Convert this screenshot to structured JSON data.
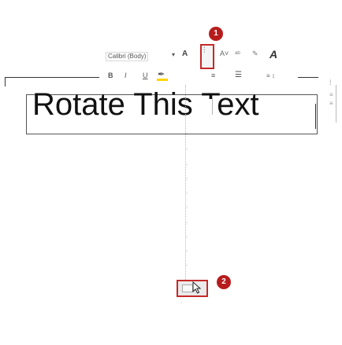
{
  "slide": {
    "text": "Rotate This Text"
  },
  "mini_toolbar": {
    "font_name": "Calibri (Body)",
    "font_dropdown_glyph": "▾",
    "grow_font": "A",
    "text_direction_icon": "⫶",
    "shrink_font": "A˅",
    "style_glyph": "ᵃᵇ",
    "format_glyph": "✎",
    "font_color": "A",
    "bold": "B",
    "italic": "I",
    "underline": "U",
    "highlight": "✒",
    "center": "≡",
    "bullets": "☰",
    "spacing": "≡ ↕"
  },
  "text_direction_menu": {
    "items": [
      "ᵎ",
      "ᵎ",
      "ᵎ",
      "ᵎ",
      "ᵎ",
      "ᵎ",
      "ᵎ",
      "ᵎ",
      "ᵎ",
      "ᵎ"
    ],
    "target_option": "",
    "below_target": "ᵎ"
  },
  "right_panel": {
    "icon_1": "⁞",
    "icon_2": "≡",
    "icon_3": "≡"
  },
  "callouts": {
    "step1": "1",
    "step2": "2"
  },
  "colors": {
    "callout_red": "#c62828",
    "badge_red": "#b71c1c",
    "highlight_yellow": "#ffd400"
  }
}
